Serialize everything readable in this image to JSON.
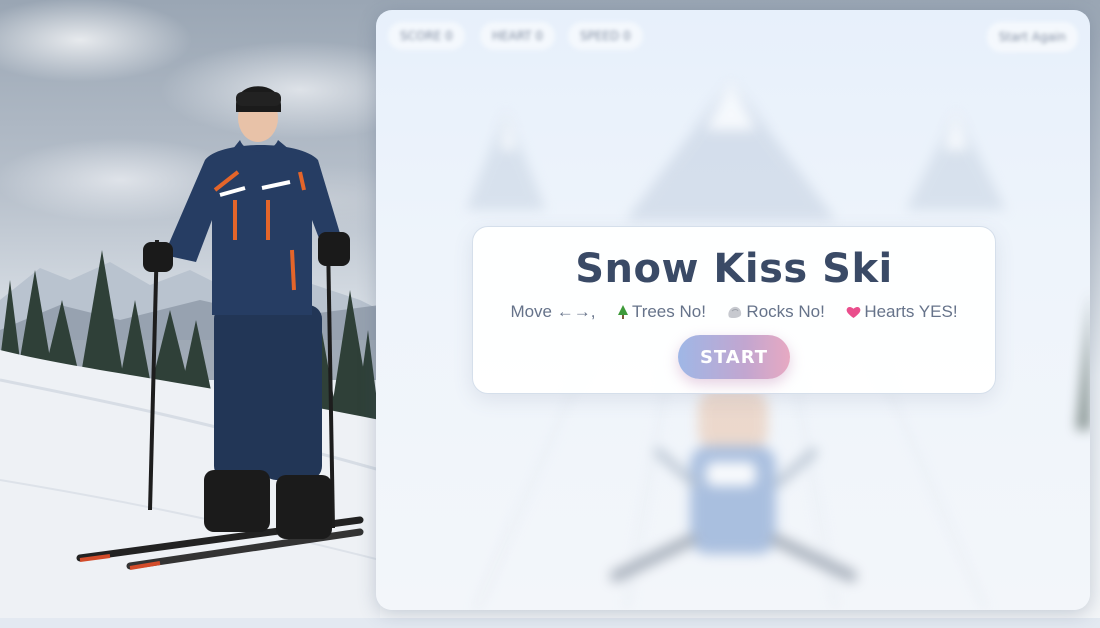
{
  "hud": {
    "score": "SCORE 0",
    "hearts": "HEART 0",
    "speed": "SPEED 0",
    "restart_label": "Start Again"
  },
  "overlay": {
    "title": "Snow Kiss Ski",
    "move_text": "Move ←→,",
    "trees_text": "Trees No!",
    "rocks_text": "Rocks No!",
    "hearts_text": "Hearts YES!",
    "start_label": "START"
  },
  "icons": {
    "tree": "tree-icon",
    "rock": "rock-icon",
    "heart": "heart-icon"
  },
  "colors": {
    "title": "#3a4a66",
    "start_gradient": [
      "#9fb7e6",
      "#e7a9c2"
    ]
  }
}
